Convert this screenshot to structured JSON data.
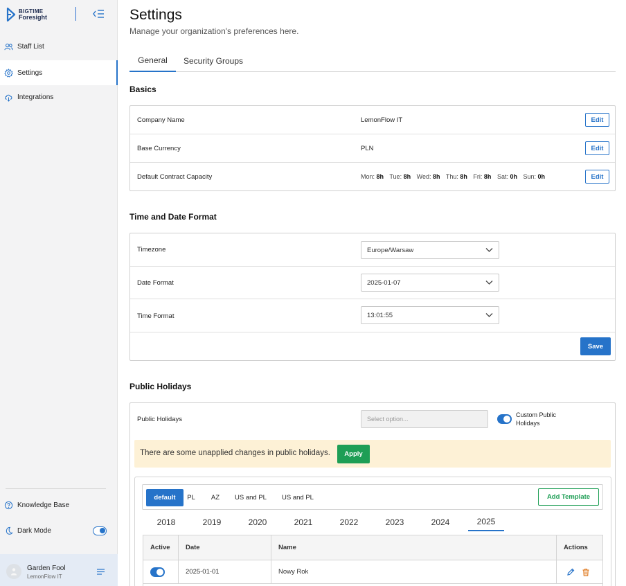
{
  "app": {
    "logo_line1": "BIGTIME",
    "logo_line2": "Foresight",
    "brand_color": "#2673c9"
  },
  "sidebar": {
    "items": [
      {
        "label": "Staff List",
        "icon": "people-icon"
      },
      {
        "label": "Settings",
        "icon": "gear-icon",
        "active": true
      },
      {
        "label": "Integrations",
        "icon": "cloud-icon"
      }
    ],
    "bottom": {
      "knowledge_base": "Knowledge Base",
      "dark_mode": "Dark Mode",
      "dark_mode_enabled": true
    },
    "user": {
      "name": "Garden Fool",
      "org": "LemonFlow IT"
    }
  },
  "header": {
    "title": "Settings",
    "subtitle": "Manage your organization's preferences here."
  },
  "tabs": [
    {
      "label": "General",
      "active": true
    },
    {
      "label": "Security Groups",
      "active": false
    }
  ],
  "basics": {
    "title": "Basics",
    "edit_label": "Edit",
    "rows": [
      {
        "label": "Company Name",
        "value": "LemonFlow IT"
      },
      {
        "label": "Base Currency",
        "value": "PLN"
      },
      {
        "label": "Default Contract Capacity",
        "value": ""
      }
    ],
    "capacity": [
      {
        "day": "Mon:",
        "hours": "8h"
      },
      {
        "day": "Tue:",
        "hours": "8h"
      },
      {
        "day": "Wed:",
        "hours": "8h"
      },
      {
        "day": "Thu:",
        "hours": "8h"
      },
      {
        "day": "Fri:",
        "hours": "8h"
      },
      {
        "day": "Sat:",
        "hours": "0h"
      },
      {
        "day": "Sun:",
        "hours": "0h"
      }
    ]
  },
  "time_date": {
    "title": "Time and Date Format",
    "rows": [
      {
        "label": "Timezone",
        "value": "Europe/Warsaw"
      },
      {
        "label": "Date Format",
        "value": "2025-01-07"
      },
      {
        "label": "Time Format",
        "value": "13:01:55"
      }
    ],
    "save_label": "Save"
  },
  "holidays": {
    "title": "Public Holidays",
    "label": "Public Holidays",
    "placeholder": "Select option...",
    "custom_label": "Custom Public Holidays",
    "custom_enabled": true,
    "warning": "There are some unapplied changes in public holidays.",
    "apply_label": "Apply",
    "templates": [
      "default",
      "PL",
      "AZ",
      "US and PL",
      "US and PL"
    ],
    "active_template": "default",
    "add_template_label": "Add Template",
    "years": [
      "2018",
      "2019",
      "2020",
      "2021",
      "2022",
      "2023",
      "2024",
      "2025"
    ],
    "active_year": "2025",
    "table": {
      "headers": [
        "Active",
        "Date",
        "Name",
        "Actions"
      ],
      "rows": [
        {
          "active": true,
          "date": "2025-01-01",
          "name": "Nowy Rok"
        }
      ]
    },
    "accent_green": "#1e9e55",
    "warning_bg": "#fdf1d6"
  }
}
